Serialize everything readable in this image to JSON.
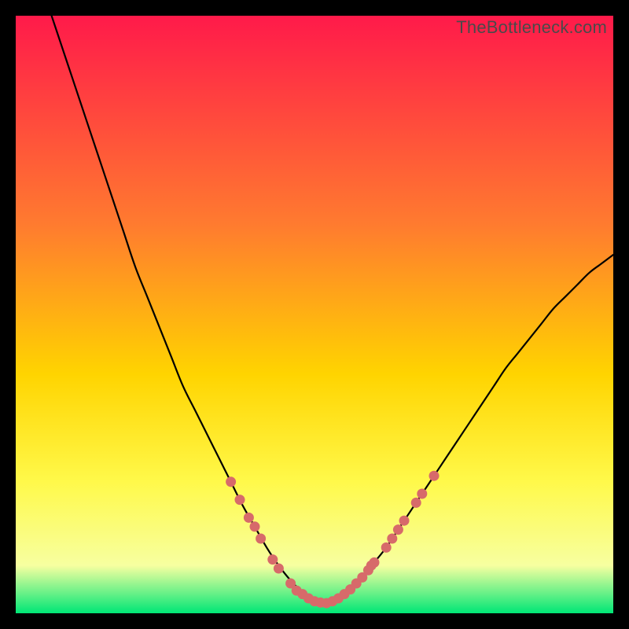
{
  "watermark": "TheBottleneck.com",
  "colors": {
    "bg_top": "#ff1a4a",
    "bg_mid1": "#ff7b2f",
    "bg_mid2": "#ffd400",
    "bg_mid3": "#fff94a",
    "bg_low": "#f7ffa0",
    "bg_bottom": "#00e676",
    "curve": "#000000",
    "marker_fill": "#d76a6a",
    "marker_stroke": "#c05a5a"
  },
  "chart_data": {
    "type": "line",
    "title": "",
    "xlabel": "",
    "ylabel": "",
    "xlim": [
      0,
      100
    ],
    "ylim": [
      0,
      100
    ],
    "series": [
      {
        "name": "bottleneck-curve",
        "x": [
          6,
          8,
          10,
          12,
          14,
          16,
          18,
          20,
          22,
          24,
          26,
          28,
          30,
          32,
          34,
          36,
          38,
          40,
          42,
          44,
          46,
          48,
          50,
          52,
          54,
          56,
          58,
          60,
          62,
          64,
          66,
          68,
          70,
          72,
          74,
          76,
          78,
          80,
          82,
          84,
          86,
          88,
          90,
          92,
          94,
          96,
          98,
          100
        ],
        "y": [
          100,
          94,
          88,
          82,
          76,
          70,
          64,
          58,
          53,
          48,
          43,
          38,
          34,
          30,
          26,
          22,
          18,
          14.5,
          11,
          8,
          5.5,
          3.5,
          2,
          1.5,
          2.5,
          4,
          6,
          8.5,
          11,
          14,
          17,
          20,
          23,
          26,
          29,
          32,
          35,
          38,
          41,
          43.5,
          46,
          48.5,
          51,
          53,
          55,
          57,
          58.5,
          60
        ]
      }
    ],
    "markers": [
      {
        "x": 36,
        "y": 22
      },
      {
        "x": 37.5,
        "y": 19
      },
      {
        "x": 39,
        "y": 16
      },
      {
        "x": 40,
        "y": 14.5
      },
      {
        "x": 41,
        "y": 12.5
      },
      {
        "x": 43,
        "y": 9
      },
      {
        "x": 44,
        "y": 7.5
      },
      {
        "x": 46,
        "y": 5
      },
      {
        "x": 47,
        "y": 3.8
      },
      {
        "x": 48,
        "y": 3.2
      },
      {
        "x": 49,
        "y": 2.5
      },
      {
        "x": 50,
        "y": 2
      },
      {
        "x": 51,
        "y": 1.8
      },
      {
        "x": 52,
        "y": 1.7
      },
      {
        "x": 53,
        "y": 2
      },
      {
        "x": 54,
        "y": 2.5
      },
      {
        "x": 55,
        "y": 3.2
      },
      {
        "x": 56,
        "y": 4
      },
      {
        "x": 57,
        "y": 5
      },
      {
        "x": 58,
        "y": 6
      },
      {
        "x": 59,
        "y": 7.2
      },
      {
        "x": 59.5,
        "y": 8
      },
      {
        "x": 60,
        "y": 8.5
      },
      {
        "x": 62,
        "y": 11
      },
      {
        "x": 63,
        "y": 12.5
      },
      {
        "x": 64,
        "y": 14
      },
      {
        "x": 65,
        "y": 15.5
      },
      {
        "x": 67,
        "y": 18.5
      },
      {
        "x": 68,
        "y": 20
      },
      {
        "x": 70,
        "y": 23
      }
    ]
  }
}
